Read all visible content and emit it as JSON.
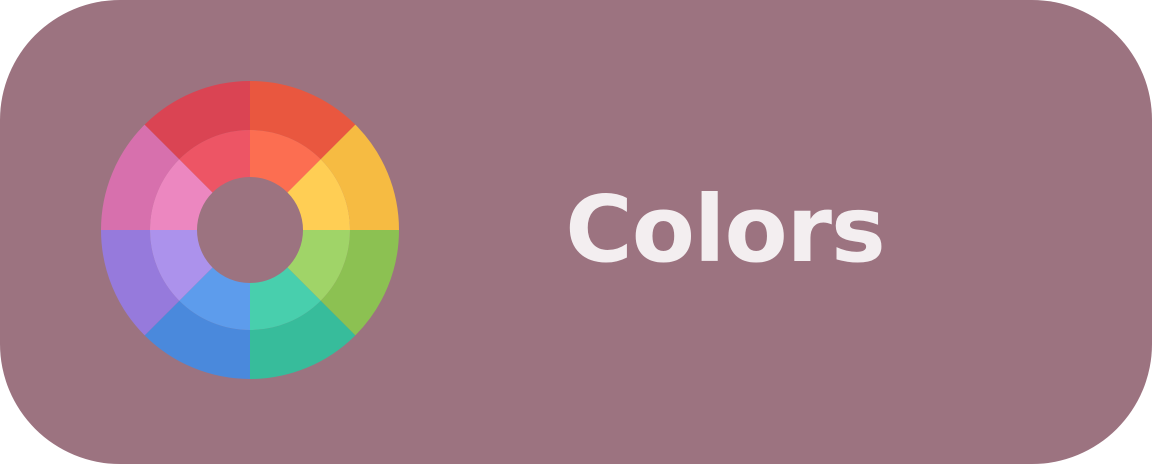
{
  "button": {
    "label": "Colors",
    "background": "#9C7380",
    "text_color": "#F3EEF0"
  },
  "icon": {
    "name": "color-wheel-icon",
    "segments": [
      {
        "outer": "#E9573F",
        "inner": "#FC6E51"
      },
      {
        "outer": "#F6BB42",
        "inner": "#FFCE54"
      },
      {
        "outer": "#8CC152",
        "inner": "#A0D468"
      },
      {
        "outer": "#37BC9B",
        "inner": "#48CFAD"
      },
      {
        "outer": "#4A89DC",
        "inner": "#5D9CEC"
      },
      {
        "outer": "#967ADC",
        "inner": "#AC92EC"
      },
      {
        "outer": "#D770AD",
        "inner": "#EC87C0"
      },
      {
        "outer": "#DA4453",
        "inner": "#ED5565"
      }
    ]
  }
}
